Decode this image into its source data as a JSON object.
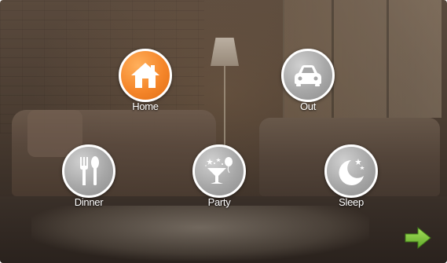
{
  "modes": {
    "home": {
      "label": "Home",
      "icon": "house-icon",
      "active": true
    },
    "out": {
      "label": "Out",
      "icon": "car-icon"
    },
    "dinner": {
      "label": "Dinner",
      "icon": "fork-spoon-icon"
    },
    "party": {
      "label": "Party",
      "icon": "cocktail-glass-icon"
    },
    "sleep": {
      "label": "Sleep",
      "icon": "moon-stars-icon"
    }
  },
  "navigation": {
    "next_icon": "arrow-right-icon"
  },
  "colors": {
    "active": "#f5862a",
    "inactive": "#a7a7a7",
    "ring": "#ffffff",
    "arrow": "#7cc23a"
  }
}
